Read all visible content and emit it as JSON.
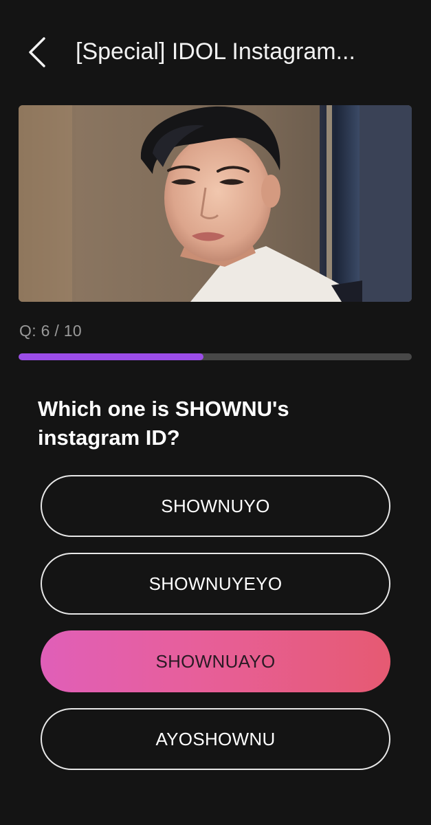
{
  "header": {
    "back_icon": "chevron-left-icon",
    "title": "[Special] IDOL Instagram..."
  },
  "quiz": {
    "counter": "Q: 6 / 10",
    "progress_fraction": 0.47,
    "progress_color": "#9b4de8",
    "question": "Which one is SHOWNU's instagram ID?",
    "options": [
      {
        "label": "SHOWNUYO",
        "selected": false
      },
      {
        "label": "SHOWNUYEYO",
        "selected": false
      },
      {
        "label": "SHOWNUAYO",
        "selected": true
      },
      {
        "label": "AYOSHOWNU",
        "selected": false
      }
    ],
    "selected_gradient": [
      "#e05fb8",
      "#e65a72"
    ]
  }
}
